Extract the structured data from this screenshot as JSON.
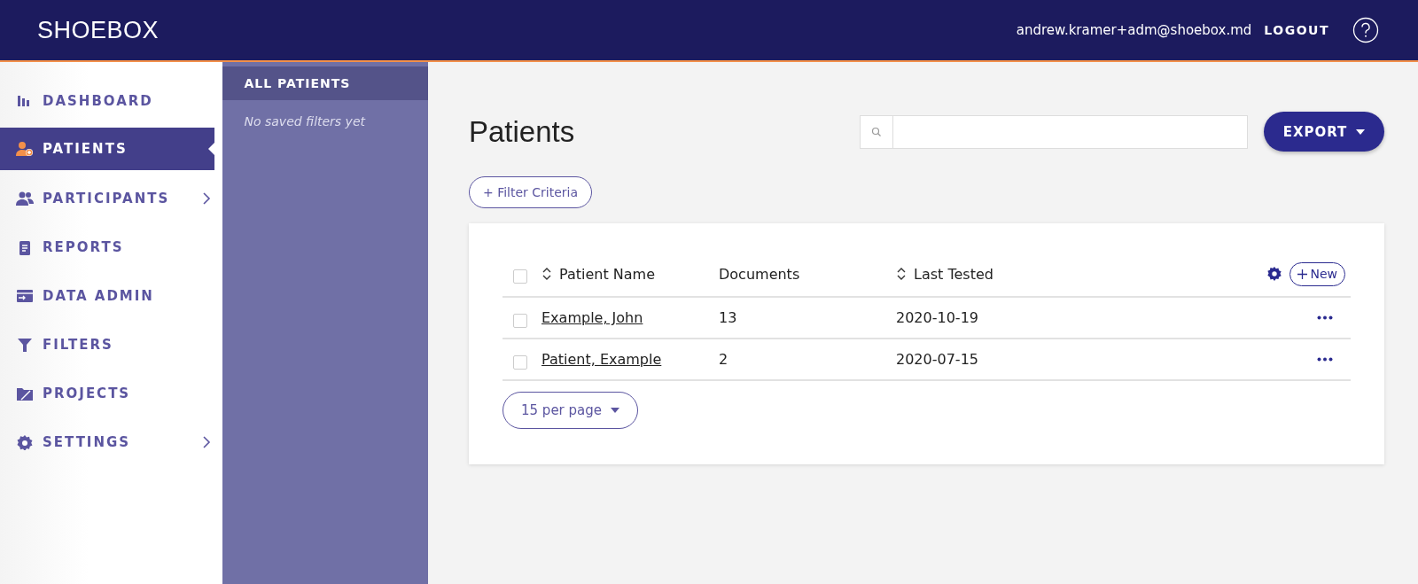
{
  "header": {
    "logo": "SHOEBOX",
    "user_email": "andrew.kramer+adm@shoebox.md",
    "logout": "LOGOUT"
  },
  "sidebar": {
    "items": [
      {
        "label": "DASHBOARD",
        "selected": false,
        "submenu": false
      },
      {
        "label": "PATIENTS",
        "selected": true,
        "submenu": false
      },
      {
        "label": "PARTICIPANTS",
        "selected": false,
        "submenu": true
      },
      {
        "label": "REPORTS",
        "selected": false,
        "submenu": false
      },
      {
        "label": "DATA ADMIN",
        "selected": false,
        "submenu": false
      },
      {
        "label": "FILTERS",
        "selected": false,
        "submenu": false
      },
      {
        "label": "PROJECTS",
        "selected": false,
        "submenu": false
      },
      {
        "label": "SETTINGS",
        "selected": false,
        "submenu": true
      }
    ]
  },
  "filters_panel": {
    "heading": "ALL PATIENTS",
    "empty_message": "No saved filters yet"
  },
  "page": {
    "title": "Patients",
    "export_button": "EXPORT",
    "filter_button": "+ Filter Criteria"
  },
  "table": {
    "select_all_checked": false,
    "new_button": "New",
    "columns": [
      {
        "label": "Patient Name",
        "sortable": true
      },
      {
        "label": "Documents",
        "sortable": false
      },
      {
        "label": "Last Tested",
        "sortable": true
      }
    ],
    "rows": [
      {
        "checked": false,
        "name": "Example, John",
        "documents": "13",
        "last_tested": "2020-10-19"
      },
      {
        "checked": false,
        "name": "Patient, Example",
        "documents": "2",
        "last_tested": "2020-07-15"
      }
    ],
    "per_page": "15 per page"
  }
}
